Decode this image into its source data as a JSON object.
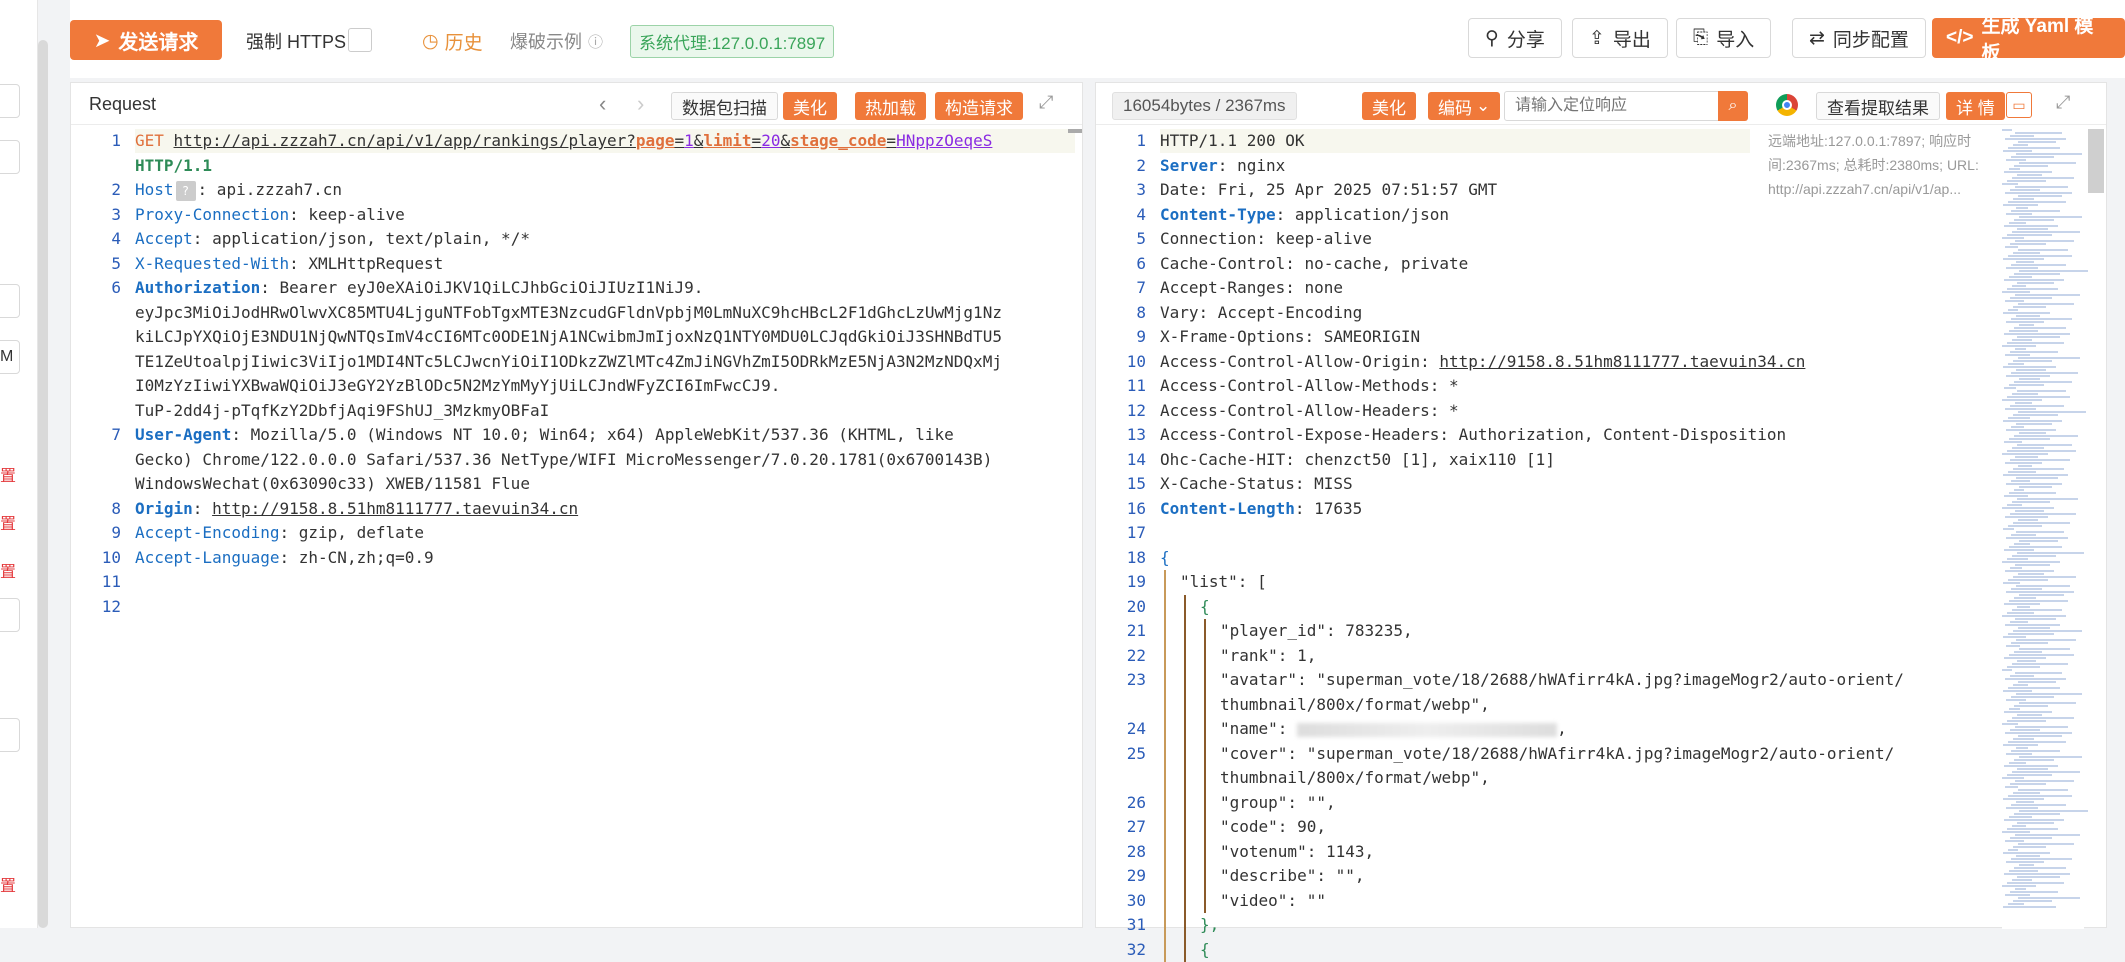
{
  "toolbar": {
    "send_label": "发送请求",
    "force_https_label": "强制 HTTPS",
    "history_label": "历史",
    "burst_label": "爆破示例",
    "proxy_label": "系统代理:127.0.0.1:7897",
    "share_label": "分享",
    "export_label": "导出",
    "import_label": "导入",
    "sync_label": "同步配置",
    "yaml_label": "生成 Yaml 模板"
  },
  "sidebar": {
    "labels": [
      "M",
      "置",
      "置",
      "置",
      "置"
    ]
  },
  "request_panel": {
    "title": "Request",
    "scan_label": "数据包扫描",
    "beautify_label": "美化",
    "hotload_label": "热加载",
    "build_label": "构造请求",
    "lines": [
      {
        "n": "1",
        "method": "GET",
        "url": "http://api.zzzah7.cn/api/v1/app/rankings/player?",
        "p1k": "page",
        "p1v": "1",
        "p2k": "limit",
        "p2v": "20",
        "p3k": "stage_code",
        "p3v": "HNppzOeqeS",
        "proto": "HTTP/1.1"
      },
      {
        "n": "2",
        "key": "Host",
        "val": " api.zzzah7.cn"
      },
      {
        "n": "3",
        "key": "Proxy-Connection",
        "val": " keep-alive"
      },
      {
        "n": "4",
        "key": "Accept",
        "val": " application/json, text/plain, */*"
      },
      {
        "n": "5",
        "key": "X-Requested-With",
        "val": " XMLHttpRequest"
      },
      {
        "n": "6",
        "key": "Authorization",
        "val": " Bearer eyJ0eXAiOiJKV1QiLCJhbGciOiJIUzI1NiJ9.",
        "cont": [
          "eyJpc3MiOiJodHRwOlwvXC85MTU4LjguNTFobTgxMTE3NzcudGFldnVpbjM0LmNuXC9hcHBcL2F1dGhcLzUwMjg1Nz",
          "kiLCJpYXQiOjE3NDU1NjQwNTQsImV4cCI6MTc0ODE1NjA1NCwibmJmIjoxNzQ1NTY0MDU0LCJqdGkiOiJ3SHNBdTU5",
          "TE1ZeUtoalpjIiwic3ViIjo1MDI4NTc5LCJwcnYiOiI1ODkzZWZlMTc4ZmJiNGVhZmI5ODRkMzE5NjA3N2MzNDQxMj",
          "I0MzYzIiwiYXBwaWQiOiJ3eGY2YzBlODc5N2MzYmMyYjUiLCJndWFyZCI6ImFwcCJ9.",
          "TuP-2dd4j-pTqfKzY2DbfjAqi9FShUJ_3MzkmyOBFaI"
        ]
      },
      {
        "n": "7",
        "key": "User-Agent",
        "val": " Mozilla/5.0 (Windows NT 10.0; Win64; x64) AppleWebKit/537.36 (KHTML, like",
        "cont": [
          "Gecko) Chrome/122.0.0.0 Safari/537.36 NetType/WIFI MicroMessenger/7.0.20.1781(0x6700143B)",
          "WindowsWechat(0x63090c33) XWEB/11581 Flue"
        ]
      },
      {
        "n": "8",
        "key": "Origin",
        "val": " http://9158.8.51hm8111777.taevuin34.cn"
      },
      {
        "n": "9",
        "key": "Accept-Encoding",
        "val": " gzip, deflate"
      },
      {
        "n": "10",
        "key": "Accept-Language",
        "val": " zh-CN,zh;q=0.9"
      },
      {
        "n": "11",
        "key": "",
        "val": ""
      },
      {
        "n": "12",
        "key": "",
        "val": ""
      }
    ]
  },
  "response_panel": {
    "size_label": "16054bytes / 2367ms",
    "beautify_label": "美化",
    "encode_label": "编码",
    "search_placeholder": "请输入定位响应",
    "extract_label": "查看提取结果",
    "detail_label": "详 情",
    "info_lines": [
      "远端地址:127.0.0.1:7897; 响应时",
      "间:2367ms; 总耗时:2380ms; URL:",
      "http://api.zzzah7.cn/api/v1/ap..."
    ],
    "lines": [
      {
        "n": "1",
        "text": "HTTP/1.1 200 OK"
      },
      {
        "n": "2",
        "key": "Server",
        "val": " nginx"
      },
      {
        "n": "3",
        "text": "Date: Fri, 25 Apr 2025 07:51:57 GMT"
      },
      {
        "n": "4",
        "key": "Content-Type",
        "val": " application/json"
      },
      {
        "n": "5",
        "text": "Connection: keep-alive"
      },
      {
        "n": "6",
        "text": "Cache-Control: no-cache, private"
      },
      {
        "n": "7",
        "text": "Accept-Ranges: none"
      },
      {
        "n": "8",
        "text": "Vary: Accept-Encoding"
      },
      {
        "n": "9",
        "text": "X-Frame-Options: SAMEORIGIN"
      },
      {
        "n": "10",
        "text": "Access-Control-Allow-Origin: ",
        "link": "http://9158.8.51hm8111777.taevuin34.cn"
      },
      {
        "n": "11",
        "text": "Access-Control-Allow-Methods: *"
      },
      {
        "n": "12",
        "text": "Access-Control-Allow-Headers: *"
      },
      {
        "n": "13",
        "text": "Access-Control-Expose-Headers: Authorization, Content-Disposition"
      },
      {
        "n": "14",
        "text": "Ohc-Cache-HIT: chenzct50 [1], xaix110 [1]"
      },
      {
        "n": "15",
        "text": "X-Cache-Status: MISS"
      },
      {
        "n": "16",
        "key": "Content-Length",
        "val": " 17635"
      },
      {
        "n": "17",
        "text": ""
      },
      {
        "n": "18",
        "text": "{",
        "indent": 0,
        "blue": true
      },
      {
        "n": "19",
        "text": "\"list\": [",
        "indent": 1
      },
      {
        "n": "20",
        "text": "{",
        "indent": 2,
        "green": true
      },
      {
        "n": "21",
        "text": "\"player_id\": 783235,",
        "indent": 3
      },
      {
        "n": "22",
        "text": "\"rank\": 1,",
        "indent": 3
      },
      {
        "n": "23",
        "text": "\"avatar\": \"superman_vote/18/2688/hWAfirr4kA.jpg?imageMogr2/auto-orient/",
        "indent": 3,
        "cont": "thumbnail/800x/format/webp\","
      },
      {
        "n": "24",
        "text": "\"name\": ",
        "indent": 3,
        "blurred": true,
        "tail": ","
      },
      {
        "n": "25",
        "text": "\"cover\": \"superman_vote/18/2688/hWAfirr4kA.jpg?imageMogr2/auto-orient/",
        "indent": 3,
        "cont": "thumbnail/800x/format/webp\","
      },
      {
        "n": "26",
        "text": "\"group\": \"\",",
        "indent": 3
      },
      {
        "n": "27",
        "text": "\"code\": 90,",
        "indent": 3
      },
      {
        "n": "28",
        "text": "\"votenum\": 1143,",
        "indent": 3
      },
      {
        "n": "29",
        "text": "\"describe\": \"\",",
        "indent": 3
      },
      {
        "n": "30",
        "text": "\"video\": \"\"",
        "indent": 3
      },
      {
        "n": "31",
        "text": "},",
        "indent": 2,
        "green": true
      },
      {
        "n": "32",
        "text": "{",
        "indent": 2,
        "green": true
      }
    ]
  }
}
